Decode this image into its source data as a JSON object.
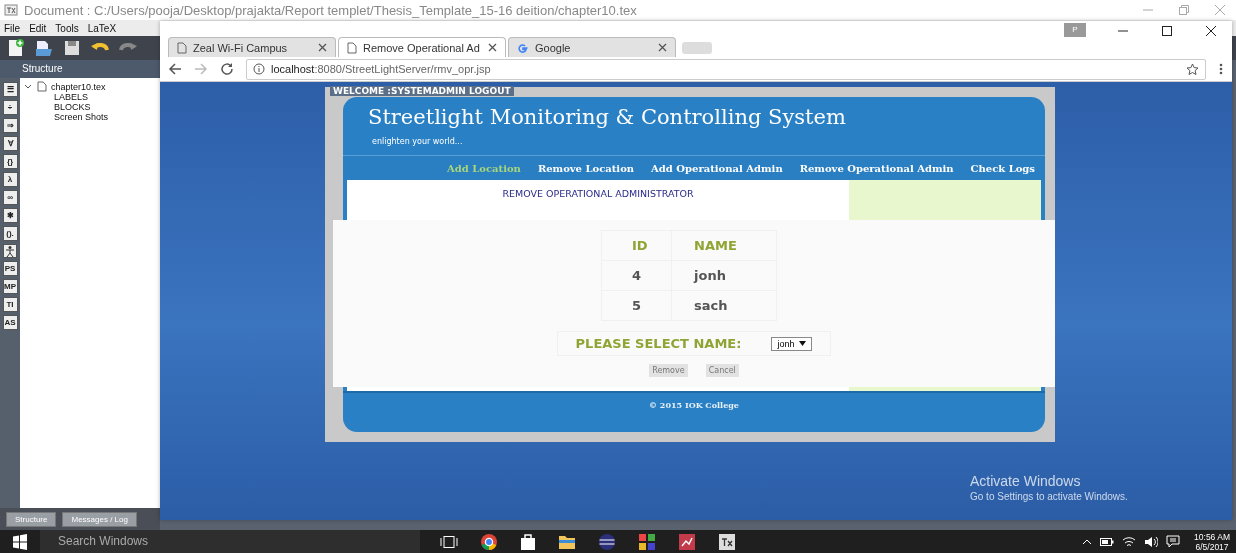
{
  "editor": {
    "title": "Document : C:/Users/pooja/Desktop/prajakta/Report templet/Thesis_Template_15-16 deition/chapter10.tex",
    "menu": [
      "File",
      "Edit",
      "Tools",
      "LaTeX"
    ],
    "structure_title": "Structure",
    "symbols": [
      {
        "kind": "text",
        "label": "☰"
      },
      {
        "kind": "text",
        "label": "÷"
      },
      {
        "kind": "text",
        "label": "⇒"
      },
      {
        "kind": "text",
        "label": "∀"
      },
      {
        "kind": "text",
        "label": "{}"
      },
      {
        "kind": "text",
        "label": "λ"
      },
      {
        "kind": "text",
        "label": "∞"
      },
      {
        "kind": "text",
        "label": "✱"
      },
      {
        "kind": "text",
        "label": "()."
      },
      {
        "kind": "person"
      },
      {
        "kind": "text",
        "label": "PS"
      },
      {
        "kind": "text",
        "label": "MP"
      },
      {
        "kind": "text",
        "label": "TI"
      },
      {
        "kind": "text",
        "label": "AS"
      }
    ],
    "tree": {
      "label": "chapter10.tex",
      "expanded": true,
      "children": [
        {
          "label": "LABELS"
        },
        {
          "label": "BLOCKS"
        },
        {
          "label": "Screen Shots"
        }
      ]
    },
    "bottom_tabs": [
      "Structure",
      "Messages / Log"
    ]
  },
  "browser": {
    "tabs": [
      {
        "title": "Zeal Wi-Fi Campus",
        "kind": "page",
        "selected": false
      },
      {
        "title": "Remove Operational Ad",
        "kind": "page",
        "selected": true
      },
      {
        "title": "Google",
        "kind": "google",
        "selected": false
      }
    ],
    "profile_badge": "P",
    "url_host": "localhost",
    "url_path": ":8080/StreetLightServer/rmv_opr.jsp"
  },
  "page": {
    "welcome": "WELCOME :SYSTEMADMIN LOGOUT",
    "title": "Streetlight Monitoring & Controlling System",
    "tagline": "enlighten your world...",
    "nav": [
      {
        "label": "Add Location",
        "selected": true
      },
      {
        "label": "Remove Location",
        "selected": false
      },
      {
        "label": "Add Operational Admin",
        "selected": false
      },
      {
        "label": "Remove Operational Admin",
        "selected": false
      },
      {
        "label": "Check Logs",
        "selected": false
      }
    ],
    "heading": "REMOVE OPERATIONAL ADMINISTRATOR",
    "table": {
      "columns": [
        "ID",
        "NAME"
      ],
      "rows": [
        [
          "4",
          "jonh"
        ],
        [
          "5",
          "sach"
        ]
      ]
    },
    "select_label": "PLEASE SELECT NAME:",
    "select_value": "jonh",
    "buttons": [
      "Remove",
      "Cancel"
    ],
    "footer": "© 2015 IOK College"
  },
  "activation": {
    "title": "Activate Windows",
    "text": "Go to Settings to activate Windows."
  },
  "taskbar": {
    "search_placeholder": "Search Windows",
    "time": "10:56 AM",
    "date": "6/5/2017"
  }
}
